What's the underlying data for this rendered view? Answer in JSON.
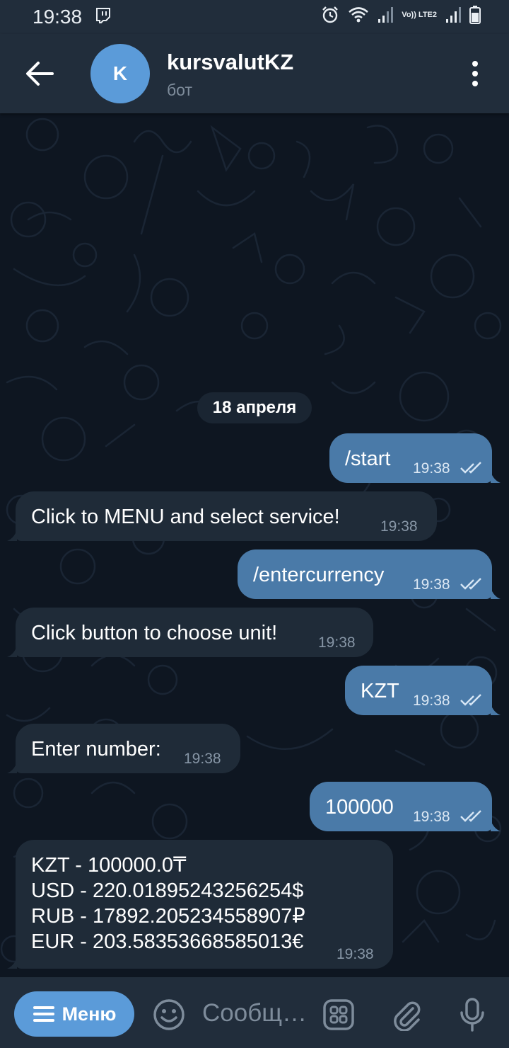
{
  "status_bar": {
    "time": "19:38",
    "network_label": "Vo)) LTE2",
    "icons": [
      "twitch-icon",
      "alarm-icon",
      "wifi-icon",
      "signal-icon",
      "battery-icon"
    ]
  },
  "header": {
    "avatar_letter": "K",
    "title": "kursvalutKZ",
    "subtitle": "бот",
    "icons": [
      "back-arrow-icon",
      "more-vertical-icon"
    ]
  },
  "chat": {
    "date": "18 апреля",
    "messages": [
      {
        "dir": "out",
        "text": "/start",
        "time": "19:38",
        "read": true
      },
      {
        "dir": "in",
        "text": "Click to MENU and select service!",
        "time": "19:38"
      },
      {
        "dir": "out",
        "text": "/entercurrency",
        "time": "19:38",
        "read": true
      },
      {
        "dir": "in",
        "text": "Click button to choose unit!",
        "time": "19:38"
      },
      {
        "dir": "out",
        "text": "KZT",
        "time": "19:38",
        "read": true
      },
      {
        "dir": "in",
        "text": "Enter number:",
        "time": "19:38"
      },
      {
        "dir": "out",
        "text": "100000",
        "time": "19:38",
        "read": true
      },
      {
        "dir": "in",
        "lines": [
          "KZT - 100000.0₸",
          "USD - 220.01895243256254$",
          "RUB - 17892.205234558907₽",
          "EUR - 203.58353668585013€"
        ],
        "time": "19:38"
      }
    ]
  },
  "input_bar": {
    "menu_label": "Меню",
    "placeholder": "Сообщ…",
    "icons": [
      "hamburger-icon",
      "emoji-icon",
      "bot-commands-icon",
      "attach-icon",
      "microphone-icon"
    ]
  },
  "colors": {
    "background": "#0e1621",
    "header": "#212d3b",
    "outgoing_bubble": "#4a7aa8",
    "incoming_bubble": "#1f2b38",
    "accent": "#5b9bd9"
  }
}
